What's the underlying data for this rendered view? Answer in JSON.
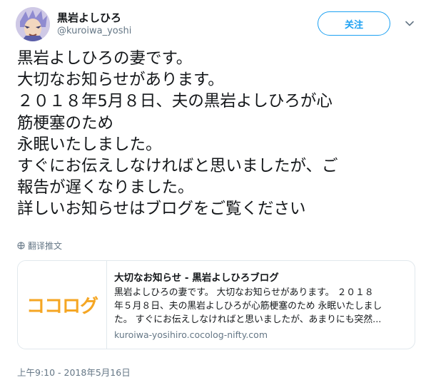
{
  "user": {
    "display_name": "黒岩よしひろ",
    "handle": "@kuroiwa_yoshi"
  },
  "header": {
    "follow_label": "关注"
  },
  "tweet": {
    "lines": [
      "黒岩よしひろの妻です。",
      "大切なお知らせがあります。",
      "２０１８年5月８日、夫の黒岩よしひろが心",
      "筋梗塞のため",
      "永眠いたしました。",
      "すぐにお伝えしなければと思いましたが、ご",
      "報告が遅くなりました。",
      "詳しいお知らせはブログをご覧ください"
    ],
    "translate_label": "翻译推文",
    "timestamp": "上午9:10 - 2018年5月16日"
  },
  "card": {
    "logo_text": "ココログ",
    "title": "大切なお知らせ - 黒岩よしひろブログ",
    "description_lines": [
      "黒岩よしひろの妻です。 大切なお知らせがあります。 ２０１８",
      "年５月８日、夫の黒岩よしひろが心筋梗塞のため 永眠いたしまし",
      "た。 すぐにお伝えしなければと思いましたが、あまりにも突然..."
    ],
    "url": "kuroiwa-yosihiro.cocolog-nifty.com"
  },
  "icons": {
    "caret": "chevron-down-icon",
    "globe": "globe-icon"
  },
  "colors": {
    "accent": "#1da1f2",
    "secondary_text": "#657786",
    "logo_orange": "#f5a623"
  }
}
